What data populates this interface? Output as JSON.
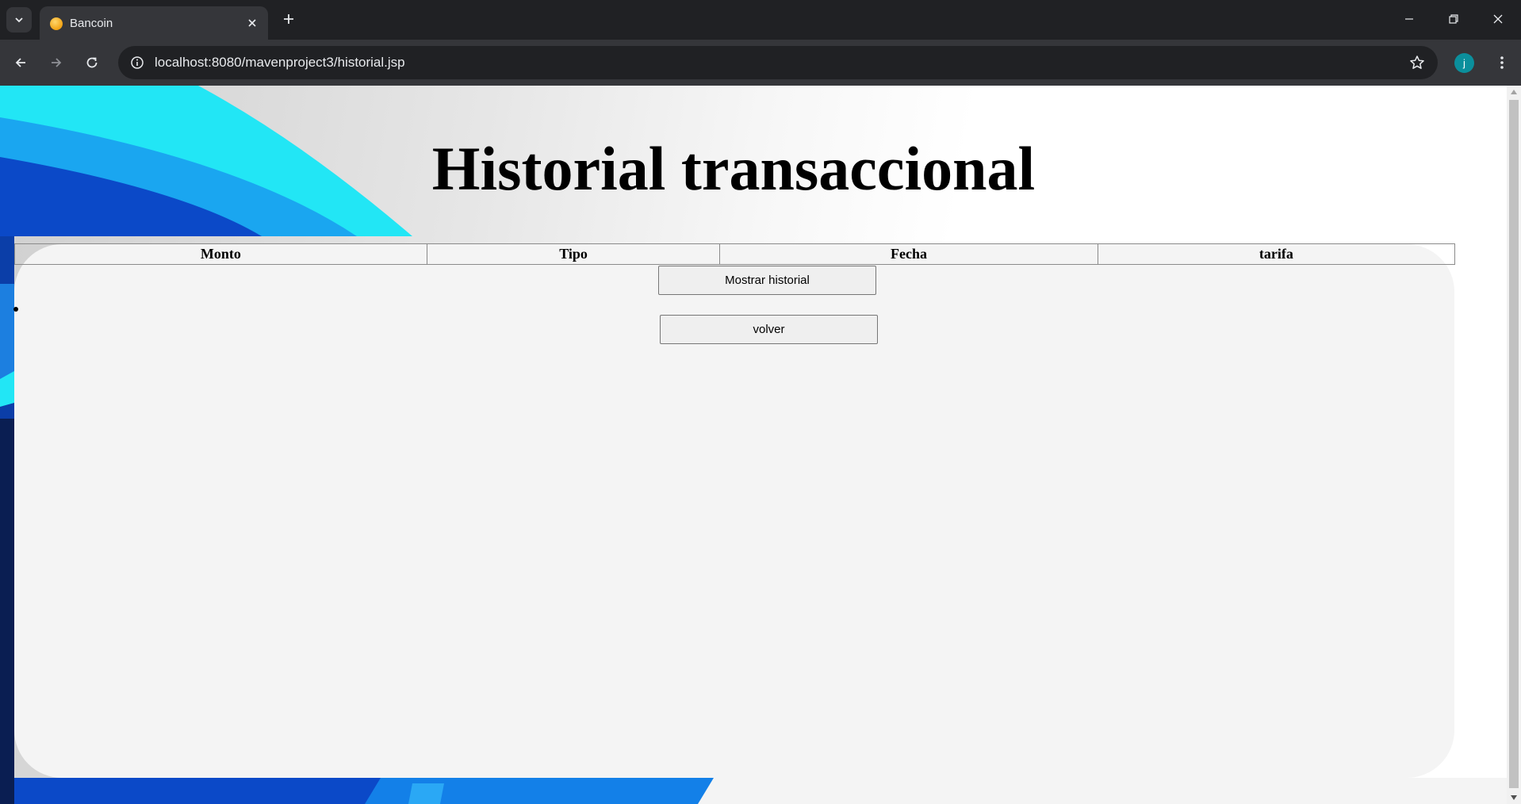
{
  "browser": {
    "tab_title": "Bancoin",
    "url": "localhost:8080/mavenproject3/historial.jsp",
    "profile_initial": "j"
  },
  "page": {
    "title": "Historial transaccional",
    "table": {
      "columns": [
        "Monto",
        "Tipo",
        "Fecha",
        "tarifa"
      ],
      "rows": []
    },
    "buttons": {
      "show_history": "Mostrar historial",
      "back": "volver"
    }
  },
  "colors": {
    "accent_cyan": "#22e6f5",
    "accent_blue": "#0b49c8",
    "card_background": "#f4f4f4"
  }
}
